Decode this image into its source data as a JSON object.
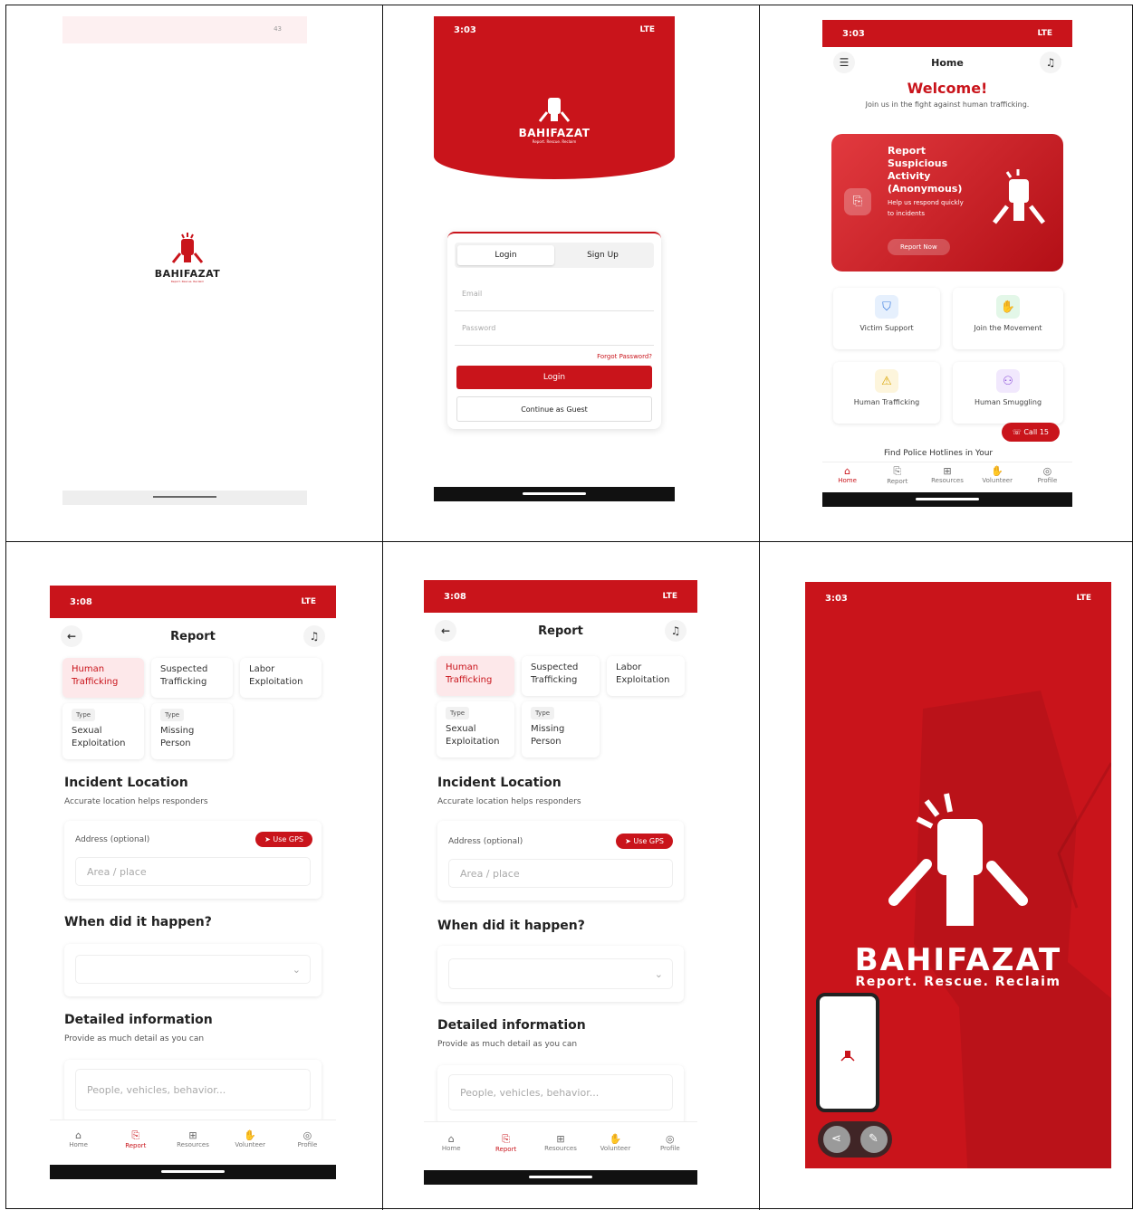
{
  "status": {
    "time1": "3:03",
    "time2": "3:08",
    "signal": "LTE",
    "battery": "43",
    "top_text": "43"
  },
  "brand": {
    "name": "BAHIFAZAT",
    "tagline": "Report. Rescue. Reclaim",
    "tagline_small": "Report. Rescue. Reclaim"
  },
  "login": {
    "tab_login": "Login",
    "tab_signup": "Sign Up",
    "email_placeholder": "Email",
    "password_placeholder": "Password",
    "forgot": "Forgot Password?",
    "login_btn": "Login",
    "guest_btn": "Continue as Guest"
  },
  "home": {
    "title": "Home",
    "welcome": "Welcome!",
    "subtitle": "Join us in the fight against human trafficking.",
    "banner_title": "Report Suspicious Activity (Anonymous)",
    "banner_sub": "Help us respond quickly to incidents",
    "banner_btn": "Report Now",
    "tiles": [
      "Victim Support",
      "Join the Movement",
      "Human Trafficking",
      "Human Smuggling"
    ],
    "call_btn": "Call 15",
    "hotline": "Find Police Hotlines in Your"
  },
  "nav": [
    "Home",
    "Report",
    "Resources",
    "Volunteer",
    "Profile"
  ],
  "report": {
    "title": "Report",
    "categories": [
      "Human Trafficking",
      "Suspected Trafficking",
      "Labor Exploitation",
      "Sexual Exploitation",
      "Missing Person"
    ],
    "type_badge": "Type",
    "loc_title": "Incident Location",
    "loc_sub": "Accurate location helps responders",
    "address_label": "Address (optional)",
    "gps_btn": "Use GPS",
    "area_placeholder": "Area / place",
    "when_title": "When did it happen?",
    "detail_title": "Detailed information",
    "detail_sub": "Provide as much detail as you can",
    "detail_placeholder": "People, vehicles, behavior..."
  },
  "colors": {
    "brand": "#c9141b"
  }
}
